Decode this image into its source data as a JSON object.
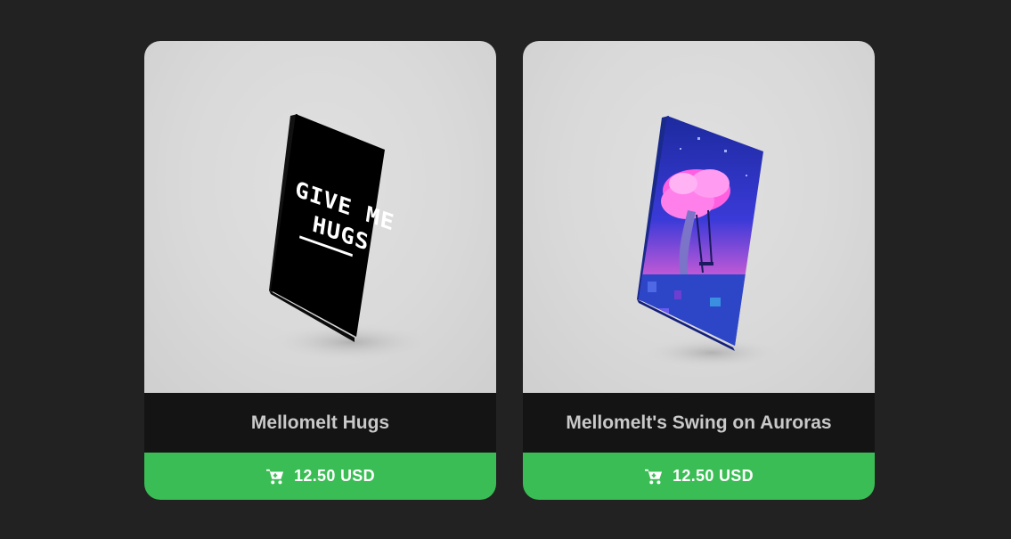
{
  "products": [
    {
      "title": "Mellomelt Hugs",
      "price": "12.50 USD",
      "art_text_line1": "GIVE ME",
      "art_text_line2": "HUGS",
      "button_color": "#3bbd55",
      "icon": "shopping-cart-icon"
    },
    {
      "title": "Mellomelt's Swing on Auroras",
      "price": "12.50 USD",
      "button_color": "#3bbd55",
      "icon": "shopping-cart-icon"
    }
  ],
  "colors": {
    "page_background": "#222222",
    "card_title_bar": "#141414",
    "card_title_text": "#c9c9c9",
    "buy_button": "#3bbd55"
  }
}
